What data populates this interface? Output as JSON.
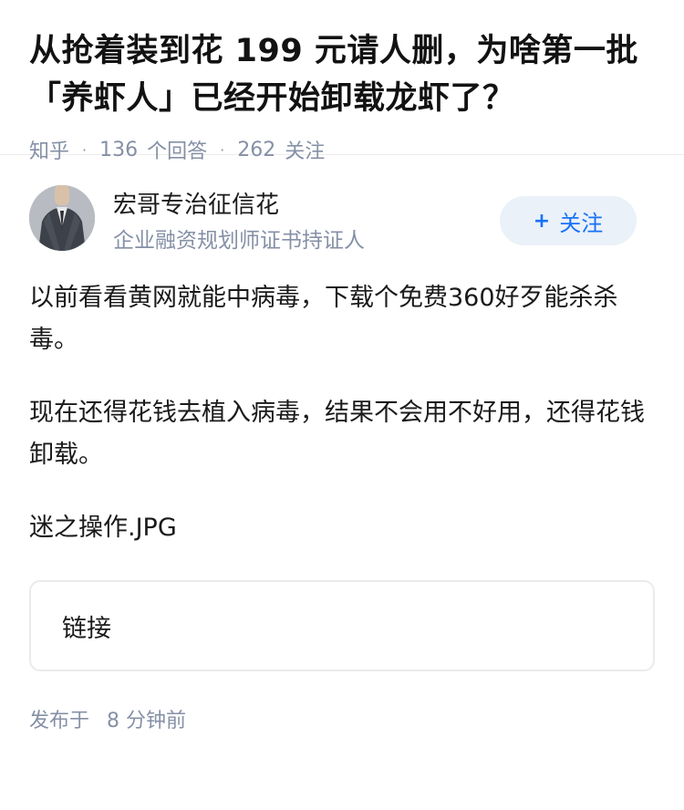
{
  "question": {
    "title": "从抢着装到花 199 元请人删，为啥第一批「养虾人」已经开始卸载龙虾了？",
    "source": "知乎",
    "answer_count": "136",
    "answer_label": "个回答",
    "follower_count": "262",
    "follower_label": "关注"
  },
  "author": {
    "name": "宏哥专治征信花",
    "bio": "企业融资规划师证书持证人",
    "follow_button": {
      "icon": "+",
      "label": "关注",
      "color": "#1772f6",
      "background": "#ebf1f9"
    }
  },
  "answer": {
    "paragraphs": [
      "以前看看黄网就能中病毒，下载个免费360好歹能杀杀毒。",
      "现在还得花钱去植入病毒，结果不会用不好用，还得花钱卸载。",
      "迷之操作.JPG"
    ],
    "link_card_label": "链接",
    "publish_label": "发布于",
    "publish_time": "8 分钟前"
  }
}
